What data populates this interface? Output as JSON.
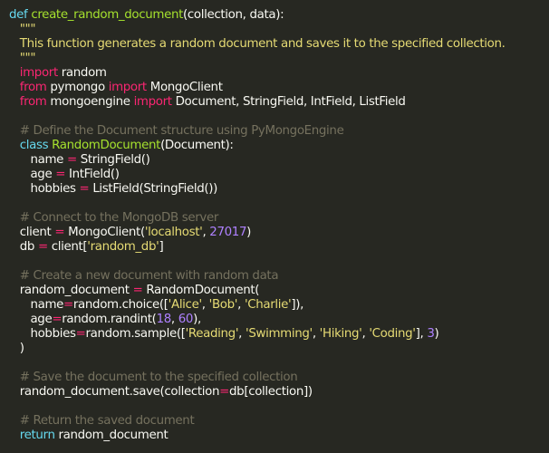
{
  "editor": {
    "indent_unit": "   ",
    "colors": {
      "background": "#272822",
      "keyword": "#66d9ef",
      "import_keyword": "#f92672",
      "function_name": "#a6e22e",
      "string": "#e6db74",
      "comment": "#75715e",
      "number": "#ae81ff",
      "operator": "#f92672",
      "plain": "#f8f8f2"
    },
    "lines": [
      {
        "indent": 0,
        "tokens": [
          {
            "t": "keyword",
            "v": "def "
          },
          {
            "t": "func",
            "v": "create_random_document"
          },
          {
            "t": "plain",
            "v": "(collection, data):"
          }
        ]
      },
      {
        "indent": 1,
        "tokens": [
          {
            "t": "string",
            "v": "\"\"\""
          }
        ]
      },
      {
        "indent": 1,
        "tokens": [
          {
            "t": "string",
            "v": "This function generates a random document and saves it to the specified collection."
          }
        ]
      },
      {
        "indent": 1,
        "tokens": [
          {
            "t": "string",
            "v": "\"\"\""
          }
        ]
      },
      {
        "indent": 1,
        "tokens": [
          {
            "t": "import",
            "v": "import"
          },
          {
            "t": "plain",
            "v": " random"
          }
        ]
      },
      {
        "indent": 1,
        "tokens": [
          {
            "t": "import",
            "v": "from"
          },
          {
            "t": "plain",
            "v": " pymongo "
          },
          {
            "t": "import",
            "v": "import"
          },
          {
            "t": "plain",
            "v": " MongoClient"
          }
        ]
      },
      {
        "indent": 1,
        "tokens": [
          {
            "t": "import",
            "v": "from"
          },
          {
            "t": "plain",
            "v": " mongoengine "
          },
          {
            "t": "import",
            "v": "import"
          },
          {
            "t": "plain",
            "v": " Document, StringField, IntField, ListField"
          }
        ]
      },
      {
        "indent": 0,
        "tokens": []
      },
      {
        "indent": 1,
        "tokens": [
          {
            "t": "comment",
            "v": "# Define the Document structure using PyMongoEngine"
          }
        ]
      },
      {
        "indent": 1,
        "tokens": [
          {
            "t": "keyword",
            "v": "class "
          },
          {
            "t": "func",
            "v": "RandomDocument"
          },
          {
            "t": "plain",
            "v": "(Document):"
          }
        ]
      },
      {
        "indent": 2,
        "tokens": [
          {
            "t": "plain",
            "v": "name "
          },
          {
            "t": "op",
            "v": "="
          },
          {
            "t": "plain",
            "v": " StringField()"
          }
        ]
      },
      {
        "indent": 2,
        "tokens": [
          {
            "t": "plain",
            "v": "age "
          },
          {
            "t": "op",
            "v": "="
          },
          {
            "t": "plain",
            "v": " IntField()"
          }
        ]
      },
      {
        "indent": 2,
        "tokens": [
          {
            "t": "plain",
            "v": "hobbies "
          },
          {
            "t": "op",
            "v": "="
          },
          {
            "t": "plain",
            "v": " ListField(StringField())"
          }
        ]
      },
      {
        "indent": 0,
        "tokens": []
      },
      {
        "indent": 1,
        "tokens": [
          {
            "t": "comment",
            "v": "# Connect to the MongoDB server"
          }
        ]
      },
      {
        "indent": 1,
        "tokens": [
          {
            "t": "plain",
            "v": "client "
          },
          {
            "t": "op",
            "v": "="
          },
          {
            "t": "plain",
            "v": " MongoClient("
          },
          {
            "t": "string",
            "v": "'localhost'"
          },
          {
            "t": "plain",
            "v": ", "
          },
          {
            "t": "number",
            "v": "27017"
          },
          {
            "t": "plain",
            "v": ")"
          }
        ]
      },
      {
        "indent": 1,
        "tokens": [
          {
            "t": "plain",
            "v": "db "
          },
          {
            "t": "op",
            "v": "="
          },
          {
            "t": "plain",
            "v": " client["
          },
          {
            "t": "string",
            "v": "'random_db'"
          },
          {
            "t": "plain",
            "v": "]"
          }
        ]
      },
      {
        "indent": 0,
        "tokens": []
      },
      {
        "indent": 1,
        "tokens": [
          {
            "t": "comment",
            "v": "# Create a new document with random data"
          }
        ]
      },
      {
        "indent": 1,
        "tokens": [
          {
            "t": "plain",
            "v": "random_document "
          },
          {
            "t": "op",
            "v": "="
          },
          {
            "t": "plain",
            "v": " RandomDocument("
          }
        ]
      },
      {
        "indent": 2,
        "tokens": [
          {
            "t": "plain",
            "v": "name"
          },
          {
            "t": "op",
            "v": "="
          },
          {
            "t": "plain",
            "v": "random.choice(["
          },
          {
            "t": "string",
            "v": "'Alice'"
          },
          {
            "t": "plain",
            "v": ", "
          },
          {
            "t": "string",
            "v": "'Bob'"
          },
          {
            "t": "plain",
            "v": ", "
          },
          {
            "t": "string",
            "v": "'Charlie'"
          },
          {
            "t": "plain",
            "v": "]),"
          }
        ]
      },
      {
        "indent": 2,
        "tokens": [
          {
            "t": "plain",
            "v": "age"
          },
          {
            "t": "op",
            "v": "="
          },
          {
            "t": "plain",
            "v": "random.randint("
          },
          {
            "t": "number",
            "v": "18"
          },
          {
            "t": "plain",
            "v": ", "
          },
          {
            "t": "number",
            "v": "60"
          },
          {
            "t": "plain",
            "v": "),"
          }
        ]
      },
      {
        "indent": 2,
        "tokens": [
          {
            "t": "plain",
            "v": "hobbies"
          },
          {
            "t": "op",
            "v": "="
          },
          {
            "t": "plain",
            "v": "random.sample(["
          },
          {
            "t": "string",
            "v": "'Reading'"
          },
          {
            "t": "plain",
            "v": ", "
          },
          {
            "t": "string",
            "v": "'Swimming'"
          },
          {
            "t": "plain",
            "v": ", "
          },
          {
            "t": "string",
            "v": "'Hiking'"
          },
          {
            "t": "plain",
            "v": ", "
          },
          {
            "t": "string",
            "v": "'Coding'"
          },
          {
            "t": "plain",
            "v": "], "
          },
          {
            "t": "number",
            "v": "3"
          },
          {
            "t": "plain",
            "v": ")"
          }
        ]
      },
      {
        "indent": 1,
        "tokens": [
          {
            "t": "plain",
            "v": ")"
          }
        ]
      },
      {
        "indent": 0,
        "tokens": []
      },
      {
        "indent": 1,
        "tokens": [
          {
            "t": "comment",
            "v": "# Save the document to the specified collection"
          }
        ]
      },
      {
        "indent": 1,
        "tokens": [
          {
            "t": "plain",
            "v": "random_document.save(collection"
          },
          {
            "t": "op",
            "v": "="
          },
          {
            "t": "plain",
            "v": "db[collection])"
          }
        ]
      },
      {
        "indent": 0,
        "tokens": []
      },
      {
        "indent": 1,
        "tokens": [
          {
            "t": "comment",
            "v": "# Return the saved document"
          }
        ]
      },
      {
        "indent": 1,
        "tokens": [
          {
            "t": "keyword",
            "v": "return"
          },
          {
            "t": "plain",
            "v": " random_document"
          }
        ]
      }
    ]
  }
}
